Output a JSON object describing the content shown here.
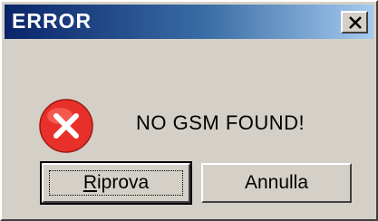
{
  "window": {
    "title": "ERROR"
  },
  "message": {
    "text": "NO GSM FOUND!",
    "icon": "error-icon"
  },
  "buttons": {
    "retry": {
      "mnemonic": "R",
      "rest": "iprova"
    },
    "cancel": {
      "label": "Annulla"
    }
  },
  "colors": {
    "title_bar_start": "#0a246a",
    "title_bar_end": "#a6caf0",
    "dialog_face": "#d4d0c8",
    "error_red": "#e8302a"
  }
}
